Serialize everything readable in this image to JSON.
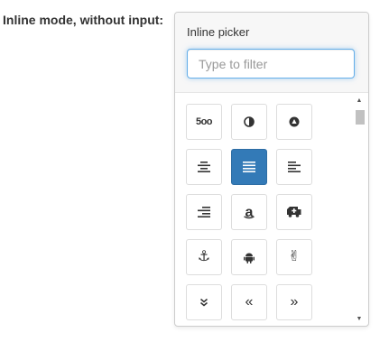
{
  "form": {
    "label": "Inline mode, without input:"
  },
  "picker": {
    "title": "Inline picker",
    "filter_placeholder": "Type to filter",
    "filter_value": "",
    "selected_icon": "align-justify-icon",
    "icons": [
      {
        "name": "500px-icon",
        "text": "5oo"
      },
      {
        "name": "adjust-icon"
      },
      {
        "name": "adn-icon"
      },
      {
        "name": "align-center-icon"
      },
      {
        "name": "align-justify-icon"
      },
      {
        "name": "align-left-icon"
      },
      {
        "name": "align-right-icon"
      },
      {
        "name": "amazon-icon",
        "text": "a"
      },
      {
        "name": "ambulance-icon"
      },
      {
        "name": "anchor-icon",
        "text": "⚓"
      },
      {
        "name": "android-icon"
      },
      {
        "name": "angellist-icon",
        "text": "✌"
      },
      {
        "name": "angle-double-down-icon"
      },
      {
        "name": "angle-double-left-icon",
        "text": "«"
      },
      {
        "name": "angle-double-right-icon",
        "text": "»"
      }
    ]
  },
  "colors": {
    "selected_bg": "#337ab7",
    "focus_border": "#66afe9",
    "header_bg": "#f7f7f7"
  }
}
